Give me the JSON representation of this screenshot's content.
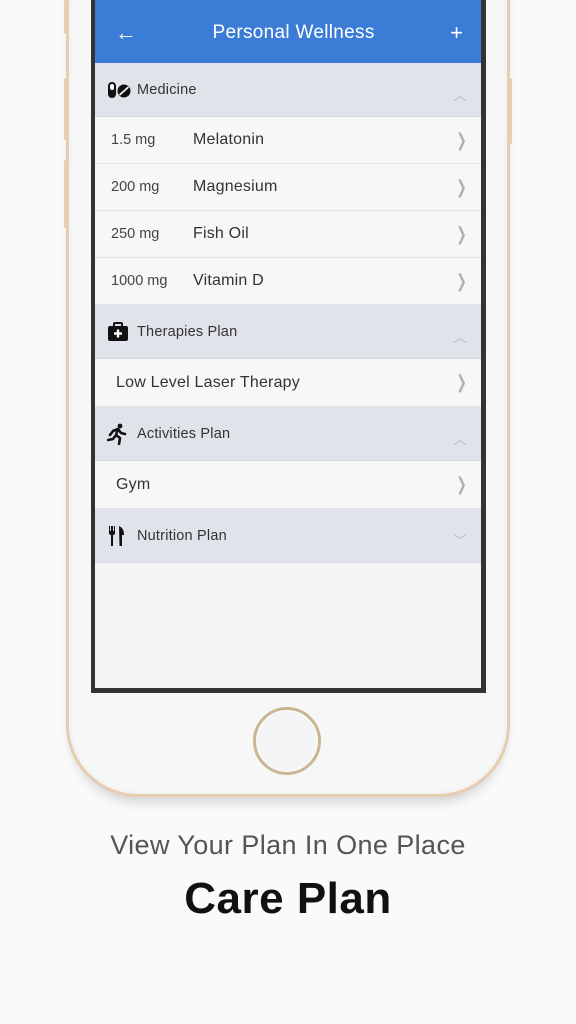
{
  "header": {
    "title": "Personal Wellness",
    "back_icon": "arrow-left-icon",
    "add_icon": "plus-icon"
  },
  "sections": [
    {
      "title": "Medicine",
      "icon": "pills-icon",
      "expanded": true,
      "items": [
        {
          "dose": "1.5 mg",
          "name": "Melatonin"
        },
        {
          "dose": "200 mg",
          "name": "Magnesium"
        },
        {
          "dose": "250 mg",
          "name": "Fish Oil"
        },
        {
          "dose": "1000 mg",
          "name": "Vitamin D"
        }
      ]
    },
    {
      "title": "Therapies Plan",
      "icon": "medical-kit-icon",
      "expanded": true,
      "items": [
        {
          "name": "Low Level Laser Therapy"
        }
      ]
    },
    {
      "title": "Activities Plan",
      "icon": "running-icon",
      "expanded": true,
      "items": [
        {
          "name": "Gym"
        }
      ]
    },
    {
      "title": "Nutrition Plan",
      "icon": "fork-knife-icon",
      "expanded": false,
      "items": []
    }
  ],
  "glyphs": {
    "back": "←",
    "add": "+",
    "chevron_up": "︿",
    "chevron_down": "﹀",
    "arrow_right": "❯"
  },
  "colors": {
    "header_blue": "#3b7dd6",
    "section_bg": "#e1e3ea",
    "phone_gold": "#e6cdb0"
  },
  "marketing": {
    "tagline": "View Your Plan In One Place",
    "caption": "Care Plan"
  }
}
